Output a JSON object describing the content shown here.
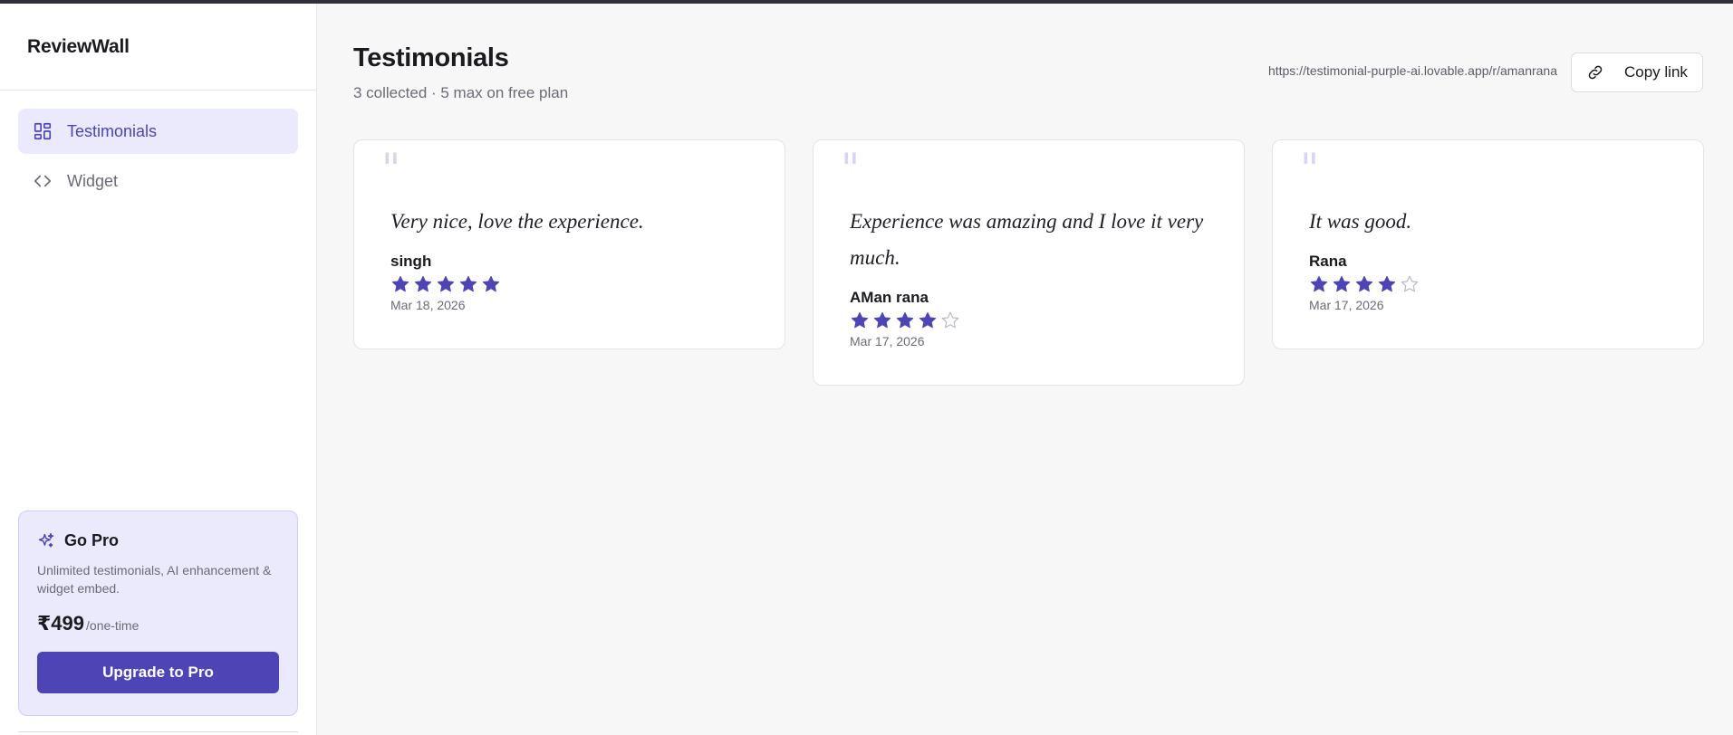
{
  "app": {
    "brand": "ReviewWall"
  },
  "sidebar": {
    "items": [
      {
        "label": "Testimonials",
        "icon": "dashboard-grid-icon",
        "active": true
      },
      {
        "label": "Widget",
        "icon": "code-icon",
        "active": false
      }
    ],
    "pro": {
      "title": "Go Pro",
      "description": "Unlimited testimonials, AI enhancement & widget embed.",
      "price": "₹499",
      "period": "/one-time",
      "button": "Upgrade to Pro"
    }
  },
  "header": {
    "title": "Testimonials",
    "subtitle": "3 collected · 5 max on free plan",
    "share_url": "https://testimonial-purple-ai.lovable.app/r/amanrana",
    "copy_label": "Copy link"
  },
  "testimonials": [
    {
      "quote": "Very nice, love the experience.",
      "author": "singh",
      "rating": 5,
      "max_rating": 5,
      "date": "Mar 18, 2026"
    },
    {
      "quote": "Experience was amazing and I love it very much.",
      "author": "AMan rana",
      "rating": 4,
      "max_rating": 5,
      "date": "Mar 17, 2026"
    },
    {
      "quote": "It was good.",
      "author": "Rana",
      "rating": 4,
      "max_rating": 5,
      "date": "Mar 17, 2026"
    }
  ],
  "colors": {
    "accent": "#4d44b5",
    "accent_light": "#ebeafd",
    "star_filled": "#4d44b5",
    "star_empty": "#b8b8c0"
  }
}
